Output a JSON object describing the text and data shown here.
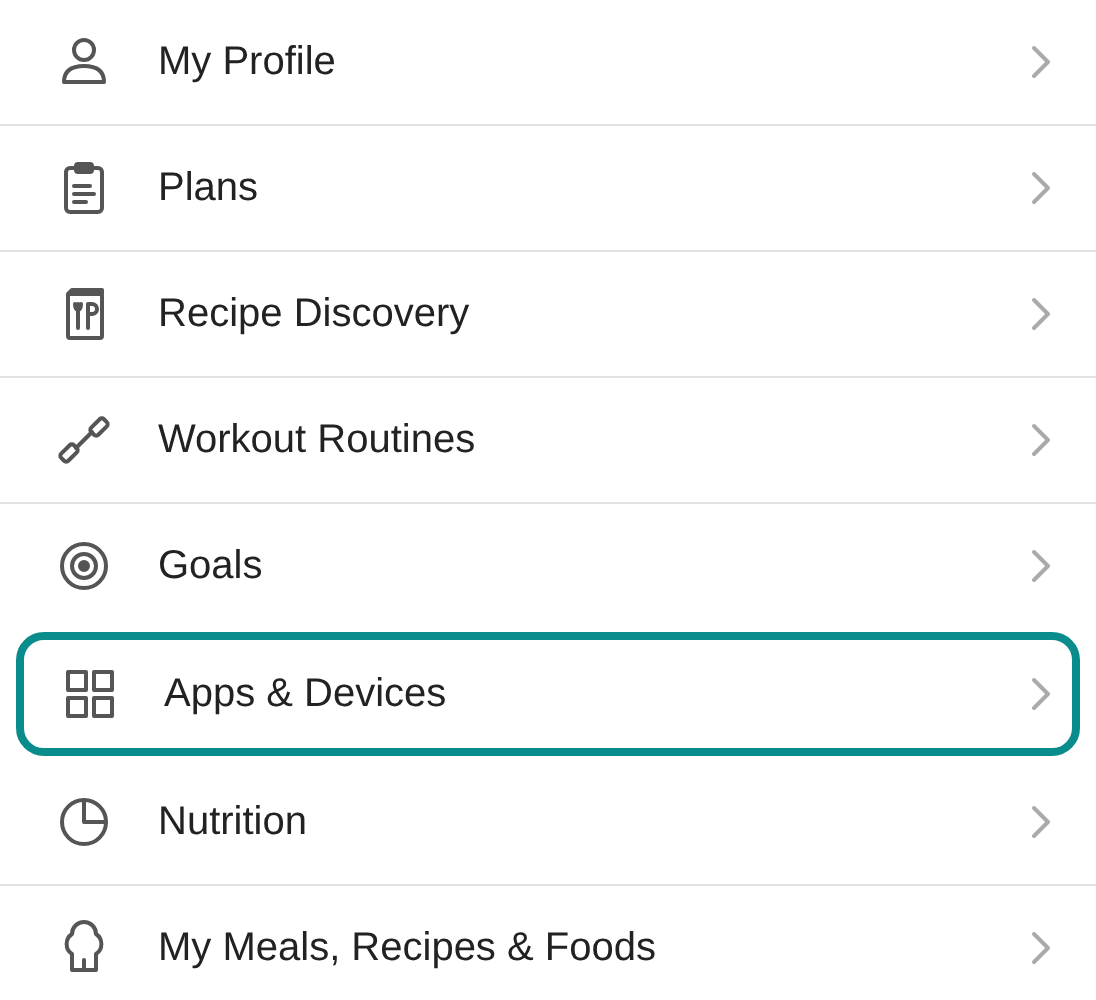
{
  "menu": [
    {
      "label": "My Profile",
      "selected": false
    },
    {
      "label": "Plans",
      "selected": false
    },
    {
      "label": "Recipe Discovery",
      "selected": false
    },
    {
      "label": "Workout Routines",
      "selected": false
    },
    {
      "label": "Goals",
      "selected": false
    },
    {
      "label": "Apps & Devices",
      "selected": true
    },
    {
      "label": "Nutrition",
      "selected": false
    },
    {
      "label": "My Meals, Recipes & Foods",
      "selected": false
    }
  ]
}
